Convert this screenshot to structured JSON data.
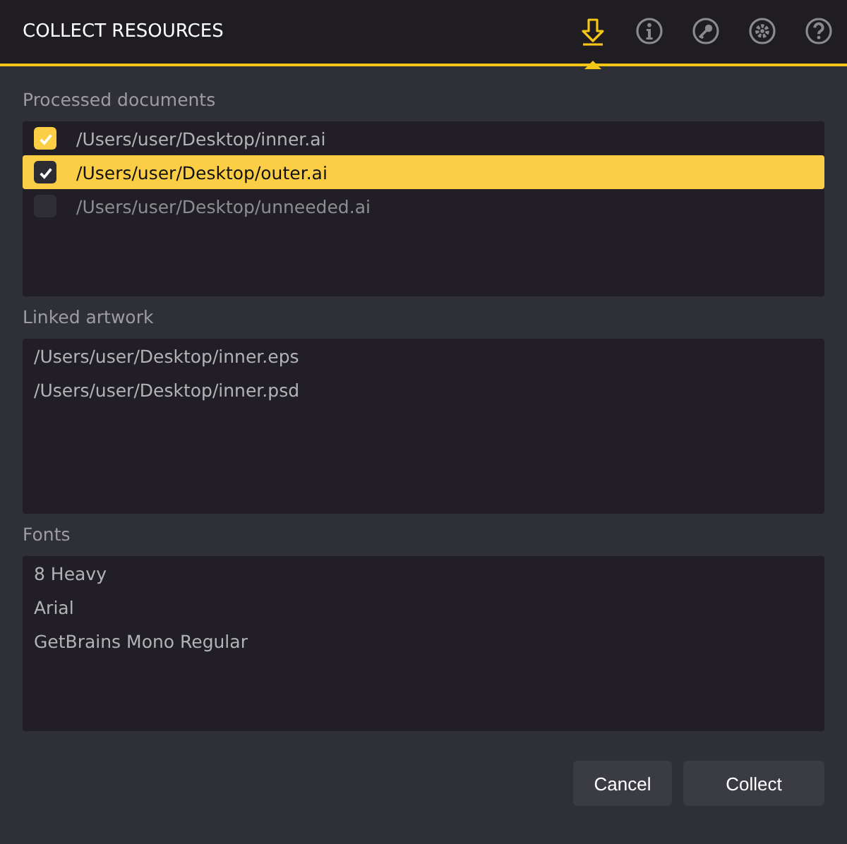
{
  "window": {
    "title": "COLLECT RESOURCES"
  },
  "tabs": [
    {
      "kind": "download",
      "selected": true
    },
    {
      "kind": "info",
      "selected": false
    },
    {
      "kind": "key",
      "selected": false
    },
    {
      "kind": "settings",
      "selected": false
    },
    {
      "kind": "help",
      "selected": false
    }
  ],
  "processed_documents": {
    "label": "Processed documents",
    "items": [
      {
        "path": "/Users/user/Desktop/inner.ai",
        "checked": true,
        "selected": false
      },
      {
        "path": "/Users/user/Desktop/outer.ai",
        "checked": true,
        "selected": true
      },
      {
        "path": "/Users/user/Desktop/unneeded.ai",
        "checked": false,
        "selected": false
      }
    ]
  },
  "linked_artwork": {
    "label": "Linked artwork",
    "items": [
      "/Users/user/Desktop/inner.eps",
      "/Users/user/Desktop/inner.psd"
    ]
  },
  "fonts": {
    "label": "Fonts",
    "items": [
      "8 Heavy",
      "Arial",
      "GetBrains Mono Regular"
    ]
  },
  "buttons": [
    "Cancel",
    "Collect"
  ]
}
